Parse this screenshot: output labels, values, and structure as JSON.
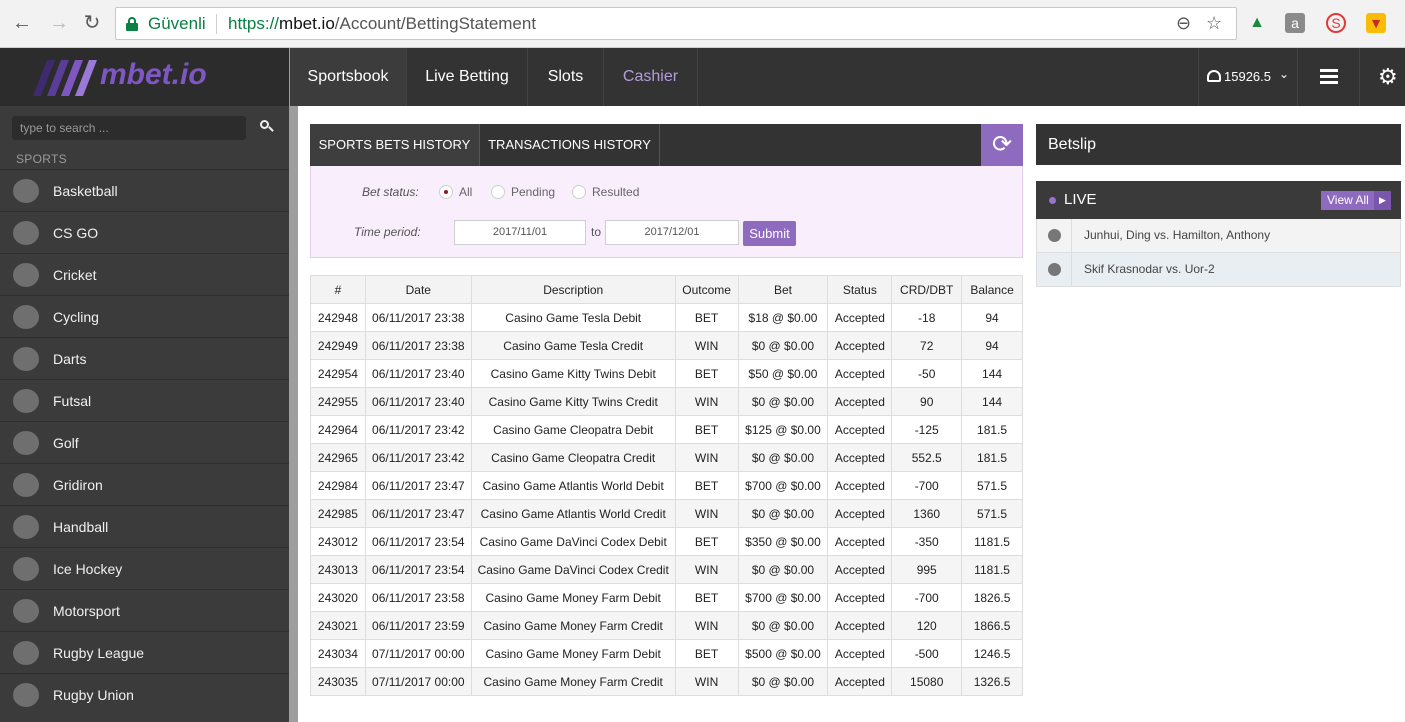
{
  "browser": {
    "secure_label": "Güvenli",
    "url_scheme": "https://",
    "url_host": "mbet.io",
    "url_path": "/Account/BettingStatement"
  },
  "brand": {
    "logo_text": "mbet.io",
    "accent": "#8e6bbf"
  },
  "sidebar": {
    "search_placeholder": "type to search ...",
    "sports_heading": "SPORTS",
    "sports": [
      {
        "label": "Basketball",
        "icon": "basketball-icon"
      },
      {
        "label": "CS GO",
        "icon": "headset-icon"
      },
      {
        "label": "Cricket",
        "icon": "cricket-icon"
      },
      {
        "label": "Cycling",
        "icon": "cycling-icon"
      },
      {
        "label": "Darts",
        "icon": "dart-icon"
      },
      {
        "label": "Futsal",
        "icon": "ball-icon"
      },
      {
        "label": "Golf",
        "icon": "golf-icon"
      },
      {
        "label": "Gridiron",
        "icon": "football-icon"
      },
      {
        "label": "Handball",
        "icon": "handball-icon"
      },
      {
        "label": "Ice Hockey",
        "icon": "puck-icon"
      },
      {
        "label": "Motorsport",
        "icon": "helmet-icon"
      },
      {
        "label": "Rugby League",
        "icon": "rugby-icon"
      },
      {
        "label": "Rugby Union",
        "icon": "rugby-icon"
      }
    ]
  },
  "topnav": {
    "items": [
      "Sportsbook",
      "Live Betting",
      "Slots",
      "Cashier"
    ],
    "balance": "15926.5"
  },
  "history": {
    "tabs": [
      "SPORTS BETS HISTORY",
      "TRANSACTIONS HISTORY"
    ],
    "bet_status_label": "Bet status:",
    "status_options": [
      "All",
      "Pending",
      "Resulted"
    ],
    "time_period_label": "Time period:",
    "date_from": "2017/11/01",
    "to_label": "to",
    "date_to": "2017/12/01",
    "submit_label": "Submit"
  },
  "table": {
    "headers": [
      "#",
      "Date",
      "Description",
      "Outcome",
      "Bet",
      "Status",
      "CRD/DBT",
      "Balance"
    ],
    "rows": [
      [
        "242948",
        "06/11/2017 23:38",
        "Casino Game Tesla Debit",
        "BET",
        "$18 @ $0.00",
        "Accepted",
        "-18",
        "94"
      ],
      [
        "242949",
        "06/11/2017 23:38",
        "Casino Game Tesla Credit",
        "WIN",
        "$0 @ $0.00",
        "Accepted",
        "72",
        "94"
      ],
      [
        "242954",
        "06/11/2017 23:40",
        "Casino Game Kitty Twins Debit",
        "BET",
        "$50 @ $0.00",
        "Accepted",
        "-50",
        "144"
      ],
      [
        "242955",
        "06/11/2017 23:40",
        "Casino Game Kitty Twins Credit",
        "WIN",
        "$0 @ $0.00",
        "Accepted",
        "90",
        "144"
      ],
      [
        "242964",
        "06/11/2017 23:42",
        "Casino Game Cleopatra Debit",
        "BET",
        "$125 @ $0.00",
        "Accepted",
        "-125",
        "181.5"
      ],
      [
        "242965",
        "06/11/2017 23:42",
        "Casino Game Cleopatra Credit",
        "WIN",
        "$0 @ $0.00",
        "Accepted",
        "552.5",
        "181.5"
      ],
      [
        "242984",
        "06/11/2017 23:47",
        "Casino Game Atlantis World Debit",
        "BET",
        "$700 @ $0.00",
        "Accepted",
        "-700",
        "571.5"
      ],
      [
        "242985",
        "06/11/2017 23:47",
        "Casino Game Atlantis World Credit",
        "WIN",
        "$0 @ $0.00",
        "Accepted",
        "1360",
        "571.5"
      ],
      [
        "243012",
        "06/11/2017 23:54",
        "Casino Game DaVinci Codex Debit",
        "BET",
        "$350 @ $0.00",
        "Accepted",
        "-350",
        "1181.5"
      ],
      [
        "243013",
        "06/11/2017 23:54",
        "Casino Game DaVinci Codex Credit",
        "WIN",
        "$0 @ $0.00",
        "Accepted",
        "995",
        "1181.5"
      ],
      [
        "243020",
        "06/11/2017 23:58",
        "Casino Game Money Farm Debit",
        "BET",
        "$700 @ $0.00",
        "Accepted",
        "-700",
        "1826.5"
      ],
      [
        "243021",
        "06/11/2017 23:59",
        "Casino Game Money Farm Credit",
        "WIN",
        "$0 @ $0.00",
        "Accepted",
        "120",
        "1866.5"
      ],
      [
        "243034",
        "07/11/2017 00:00",
        "Casino Game Money Farm Debit",
        "BET",
        "$500 @ $0.00",
        "Accepted",
        "-500",
        "1246.5"
      ],
      [
        "243035",
        "07/11/2017 00:00",
        "Casino Game Money Farm Credit",
        "WIN",
        "$0 @ $0.00",
        "Accepted",
        "15080",
        "1326.5"
      ]
    ]
  },
  "betslip": {
    "title": "Betslip",
    "live_label": "LIVE",
    "view_all_label": "View All",
    "events": [
      {
        "name": "Junhui, Ding vs. Hamilton, Anthony",
        "icon": "snooker-icon"
      },
      {
        "name": "Skif Krasnodar vs. Uor-2",
        "icon": "handball-icon"
      }
    ]
  }
}
